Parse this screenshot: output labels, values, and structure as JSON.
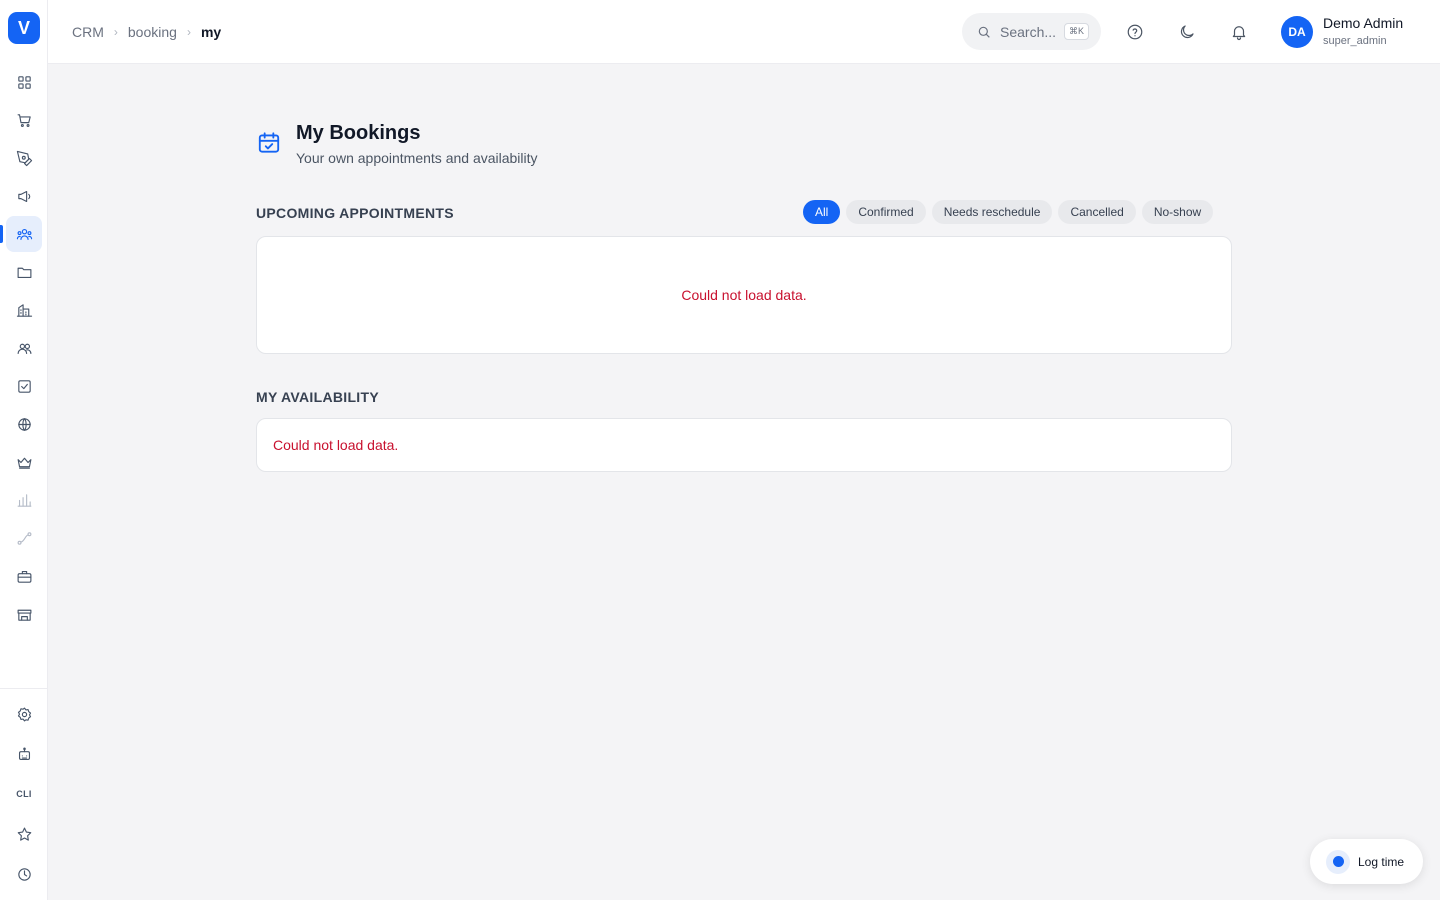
{
  "sidebar": {
    "logo": "V",
    "items": [
      {
        "icon": "grid-icon"
      },
      {
        "icon": "cart-icon"
      },
      {
        "icon": "pen-tool-icon"
      },
      {
        "icon": "megaphone-icon"
      },
      {
        "icon": "users-icon"
      },
      {
        "icon": "folder-icon"
      },
      {
        "icon": "building-icon"
      },
      {
        "icon": "team-icon"
      },
      {
        "icon": "checkbox-icon"
      },
      {
        "icon": "globe-icon"
      },
      {
        "icon": "crown-icon"
      },
      {
        "icon": "bar-chart-icon"
      },
      {
        "icon": "route-icon"
      },
      {
        "icon": "briefcase-icon"
      },
      {
        "icon": "store-icon"
      }
    ],
    "bottom": [
      {
        "icon": "gear-icon"
      },
      {
        "icon": "robot-icon"
      },
      {
        "label": "CLI"
      },
      {
        "icon": "star-icon"
      },
      {
        "icon": "clock-icon"
      }
    ],
    "accent": "#1464f4"
  },
  "header": {
    "breadcrumb": [
      "CRM",
      "booking",
      "my"
    ],
    "search_placeholder": "Search...",
    "search_shortcut": "⌘K",
    "user": {
      "initials": "DA",
      "name": "Demo Admin",
      "role": "super_admin"
    }
  },
  "page": {
    "title": "My Bookings",
    "subtitle": "Your own appointments and availability"
  },
  "upcoming": {
    "label": "UPCOMING APPOINTMENTS",
    "filters": [
      "All",
      "Confirmed",
      "Needs reschedule",
      "Cancelled",
      "No-show"
    ],
    "active_filter": "All",
    "error": "Could not load data."
  },
  "availability": {
    "label": "MY AVAILABILITY",
    "error": "Could not load data."
  },
  "log_time": {
    "label": "Log time"
  },
  "colors": {
    "error": "#c8102e",
    "primary": "#1464f4"
  }
}
